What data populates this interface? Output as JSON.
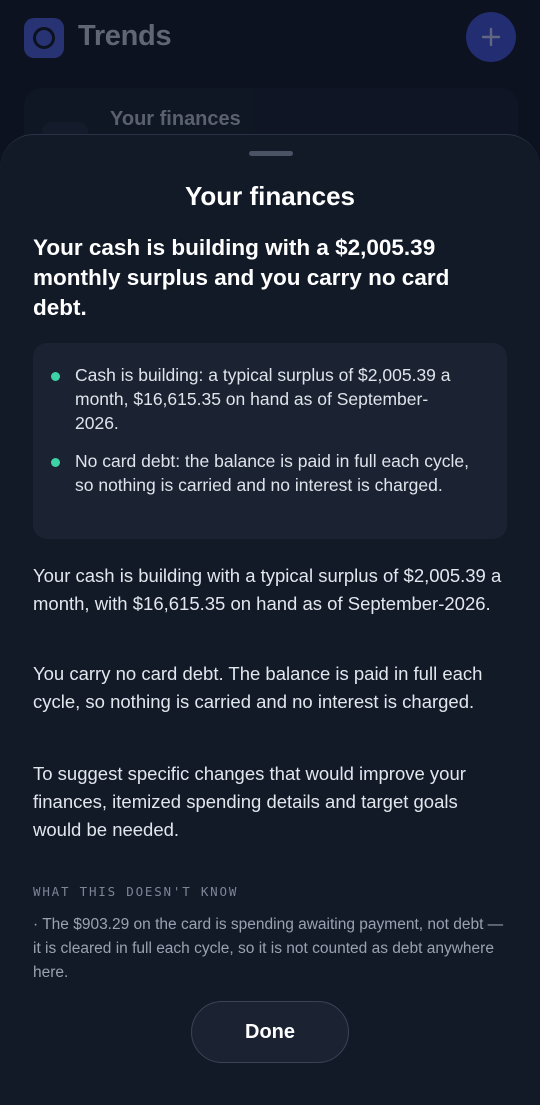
{
  "app": {
    "title": "Trends",
    "logo_icon": "app-logo-icon",
    "add_icon": "plus-icon",
    "accent_color": "#3f4fd6"
  },
  "background_card": {
    "title": "Your finances"
  },
  "sheet": {
    "title": "Your finances",
    "headline": "Your cash is building with a $2,005.39 monthly surplus and you carry no card debt.",
    "summary_bullets": [
      {
        "text": "Cash is building: a typical surplus of $2,005.39 a month, $16,615.35 on hand as of September-2026."
      },
      {
        "text": "No card debt: the balance is paid in full each cycle, so nothing is carried and no interest is charged."
      }
    ],
    "bullet_color": "#3ed3a6",
    "paragraphs": [
      "Your cash is building with a typical surplus of $2,005.39 a month, with $16,615.35 on hand as of September-2026.",
      "You carry no card debt. The balance is paid in full each cycle, so nothing is carried and no interest is charged.",
      "To suggest specific changes that would improve your finances, itemized spending details and target goals would be needed."
    ],
    "caveats_heading": "WHAT THIS DOESN'T KNOW",
    "caveats": [
      "· The $903.29 on the card is spending awaiting payment, not debt — it is cleared in full each cycle, so it is not counted as debt anywhere here."
    ],
    "done_label": "Done"
  }
}
